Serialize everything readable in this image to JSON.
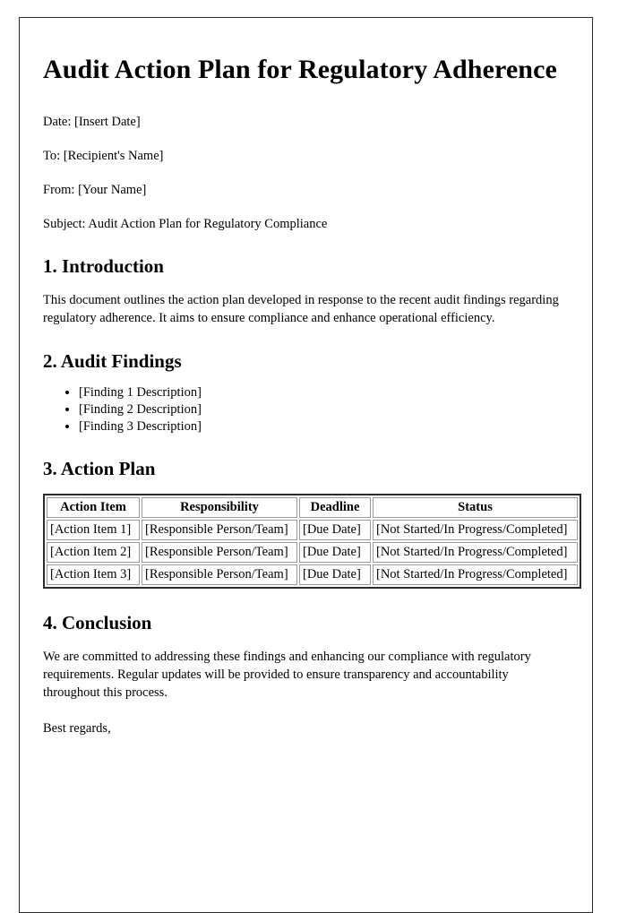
{
  "document": {
    "title": "Audit Action Plan for Regulatory Adherence",
    "meta": {
      "date": "Date: [Insert Date]",
      "to": "To: [Recipient's Name]",
      "from": "From: [Your Name]",
      "subject": "Subject: Audit Action Plan for Regulatory Compliance"
    },
    "introduction": {
      "heading": "1. Introduction",
      "paragraph": "This document outlines the action plan developed in response to the recent audit findings regarding regulatory adherence. It aims to ensure compliance and enhance operational efficiency."
    },
    "audit_findings": {
      "heading": "2. Audit Findings",
      "items": [
        "[Finding 1 Description]",
        "[Finding 2 Description]",
        "[Finding 3 Description]"
      ]
    },
    "action_plan": {
      "heading": "3. Action Plan",
      "table": {
        "columns": [
          "Action Item",
          "Responsibility",
          "Deadline",
          "Status"
        ],
        "rows": [
          {
            "action_item": "[Action Item 1]",
            "responsibility": "[Responsible Person/Team]",
            "deadline": "[Due Date]",
            "status": "[Not Started/In Progress/Completed]"
          },
          {
            "action_item": "[Action Item 2]",
            "responsibility": "[Responsible Person/Team]",
            "deadline": "[Due Date]",
            "status": "[Not Started/In Progress/Completed]"
          },
          {
            "action_item": "[Action Item 3]",
            "responsibility": "[Responsible Person/Team]",
            "deadline": "[Due Date]",
            "status": "[Not Started/In Progress/Completed]"
          }
        ]
      }
    },
    "conclusion": {
      "heading": "4. Conclusion",
      "paragraph": "We are committed to addressing these findings and enhancing our compliance with regulatory requirements. Regular updates will be provided to ensure transparency and accountability throughout this process.",
      "signoff": "Best regards,"
    }
  }
}
